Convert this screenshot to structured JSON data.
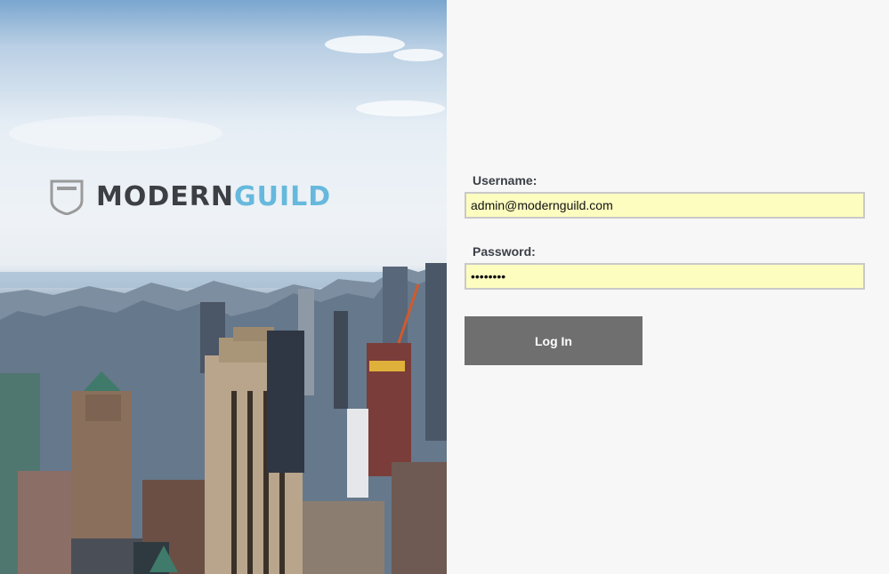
{
  "brand": {
    "name_part1": "MODERN",
    "name_part2": "GUILD",
    "accent": "#66b9dd",
    "dark": "#3c3f44",
    "shield_icon": "shield-icon"
  },
  "form": {
    "username_label": "Username:",
    "username_value": "admin@modernguild.com",
    "password_label": "Password:",
    "password_value": "password",
    "login_label": "Log In",
    "field_bg": "#fdfdc0",
    "button_bg": "#6f6f6f"
  }
}
